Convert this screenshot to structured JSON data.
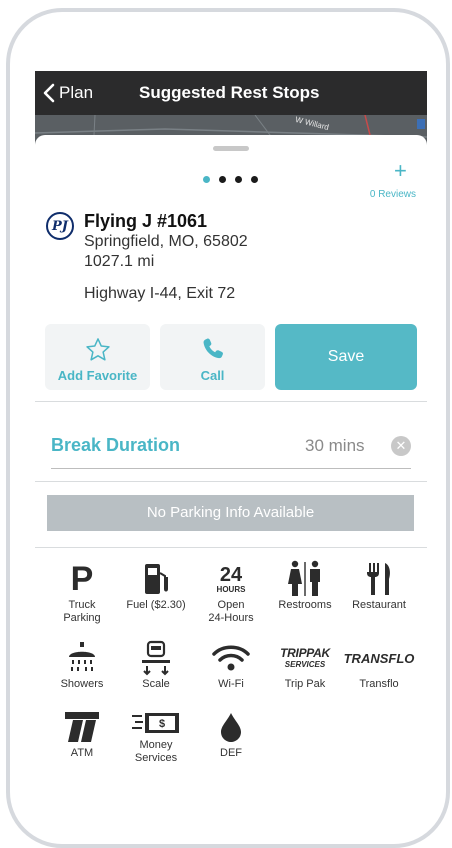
{
  "nav": {
    "back_label": "Plan",
    "title": "Suggested Rest Stops"
  },
  "map": {
    "road_label": "W Willard"
  },
  "stop": {
    "name": "Flying J #1061",
    "address": "Springfield, MO, 65802",
    "distance": "1027.1 mi",
    "highway": "Highway I-44, Exit 72",
    "reviews": "0 Reviews",
    "add_symbol": "+"
  },
  "actions": {
    "favorite": "Add Favorite",
    "call": "Call",
    "save": "Save"
  },
  "break": {
    "label": "Break Duration",
    "value": "30 mins"
  },
  "parking": {
    "status": "No Parking Info Available"
  },
  "amenities": [
    {
      "label": "Truck\nParking",
      "icon": "parking-icon"
    },
    {
      "label": "Fuel ($2.30)",
      "icon": "fuel-icon"
    },
    {
      "label": "Open\n24-Hours",
      "icon": "24-hours-icon",
      "icon_text_top": "24",
      "icon_text_bottom": "HOURS"
    },
    {
      "label": "Restrooms",
      "icon": "restroom-icon"
    },
    {
      "label": "Restaurant",
      "icon": "restaurant-icon"
    },
    {
      "label": "Showers",
      "icon": "shower-icon"
    },
    {
      "label": "Scale",
      "icon": "scale-icon"
    },
    {
      "label": "Wi-Fi",
      "icon": "wifi-icon"
    },
    {
      "label": "Trip Pak",
      "icon": "trip-pak-icon",
      "icon_text_top": "TRIPPAK",
      "icon_text_bottom": "SERVICES"
    },
    {
      "label": "Transflo",
      "icon": "transflo-icon",
      "icon_text_top": "TRANSFLO"
    },
    {
      "label": "ATM",
      "icon": "atm-icon"
    },
    {
      "label": "Money\nServices",
      "icon": "money-icon"
    },
    {
      "label": "DEF",
      "icon": "def-drop-icon"
    }
  ],
  "colors": {
    "accent": "#4ab6c6",
    "navbar": "#2b2b2c",
    "brand": "#0f2d6b"
  }
}
